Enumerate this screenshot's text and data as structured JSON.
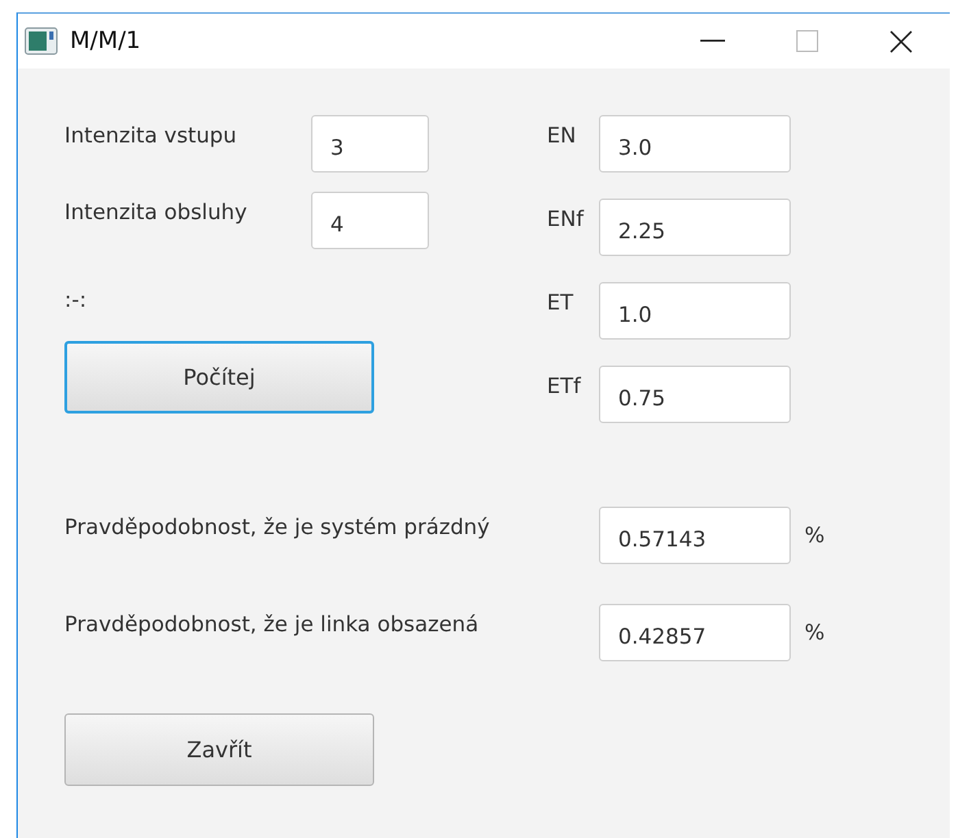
{
  "window": {
    "title": "M/M/1"
  },
  "inputs": [
    {
      "label": "Intenzita vstupu",
      "value": "3"
    },
    {
      "label": "Intenzita obsluhy",
      "value": "4"
    }
  ],
  "status": ":-:",
  "calculate_button": {
    "label": "Počítej",
    "focused": true
  },
  "results": [
    {
      "label": "EN",
      "value": "3.0"
    },
    {
      "label": "ENf",
      "value": "2.25"
    },
    {
      "label": "ET",
      "value": "1.0"
    },
    {
      "label": "ETf",
      "value": "0.75"
    }
  ],
  "probabilities": [
    {
      "label": "Pravděpodobnost, že je systém prázdný",
      "value": "0.57143",
      "unit": "%"
    },
    {
      "label": "Pravděpodobnost, že je linka obsazená",
      "value": "0.42857",
      "unit": "%"
    }
  ],
  "close_button": {
    "label": "Zavřít",
    "focused": false
  }
}
